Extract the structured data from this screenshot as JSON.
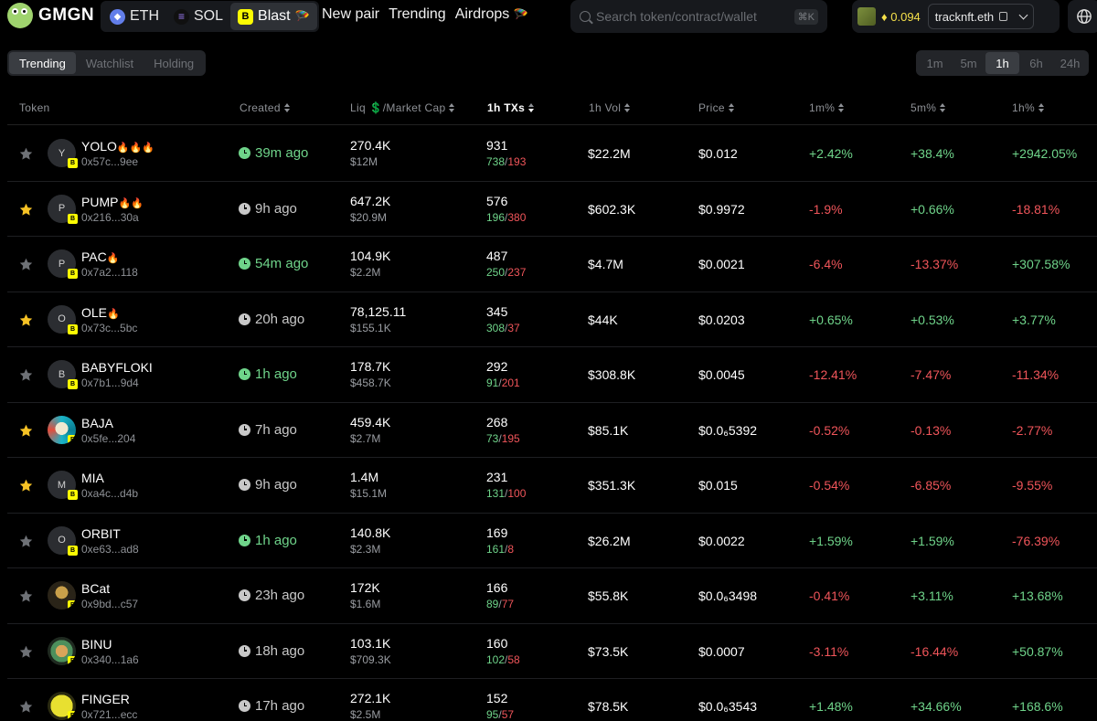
{
  "brand": {
    "name": "GMGN"
  },
  "chains": [
    {
      "label": "ETH",
      "icon": "eth-icon",
      "active": false
    },
    {
      "label": "SOL",
      "icon": "sol-icon",
      "active": false
    },
    {
      "label": "Blast",
      "icon": "blast-icon",
      "active": true
    }
  ],
  "nav": {
    "new_pair": "New pair",
    "trending": "Trending",
    "airdrops": "Airdrops"
  },
  "search": {
    "placeholder": "Search token/contract/wallet",
    "shortcut": "⌘K"
  },
  "wallet": {
    "balance": "0.094",
    "account": "tracknft.eth"
  },
  "tabs": [
    "Trending",
    "Watchlist",
    "Holding"
  ],
  "intervals": [
    "1m",
    "5m",
    "1h",
    "6h",
    "24h"
  ],
  "active_interval": "1h",
  "table": {
    "headers": {
      "token": "Token",
      "created": "Created",
      "liq": "Liq 💲/Market Cap",
      "txs": "1h TXs",
      "vol": "1h Vol",
      "price": "Price",
      "m1": "1m%",
      "m5": "5m%",
      "h1": "1h%"
    },
    "rows": [
      {
        "starred": false,
        "avatar": "Y",
        "name": "YOLO",
        "fire": "🔥🔥🔥",
        "addr": "0x57c...9ee",
        "created": "39m ago",
        "recent": true,
        "liq": "270.4K",
        "mcap": "$12M",
        "txs": "931",
        "buys": "738",
        "sells": "193",
        "vol": "$22.2M",
        "price": "$0.012",
        "m1": "+2.42%",
        "m5": "+38.4%",
        "h1": "+2942.05%"
      },
      {
        "starred": true,
        "avatar": "P",
        "name": "PUMP",
        "fire": "🔥🔥",
        "addr": "0x216...30a",
        "created": "9h ago",
        "recent": false,
        "liq": "647.2K",
        "mcap": "$20.9M",
        "txs": "576",
        "buys": "196",
        "sells": "380",
        "vol": "$602.3K",
        "price": "$0.9972",
        "m1": "-1.9%",
        "m5": "+0.66%",
        "h1": "-18.81%"
      },
      {
        "starred": false,
        "avatar": "P",
        "name": "PAC",
        "fire": "🔥",
        "addr": "0x7a2...118",
        "created": "54m ago",
        "recent": true,
        "liq": "104.9K",
        "mcap": "$2.2M",
        "txs": "487",
        "buys": "250",
        "sells": "237",
        "vol": "$4.7M",
        "price": "$0.0021",
        "m1": "-6.4%",
        "m5": "-13.37%",
        "h1": "+307.58%"
      },
      {
        "starred": true,
        "avatar": "O",
        "name": "OLE",
        "fire": "🔥",
        "addr": "0x73c...5bc",
        "created": "20h ago",
        "recent": false,
        "liq": "78,125.11",
        "mcap": "$155.1K",
        "txs": "345",
        "buys": "308",
        "sells": "37",
        "vol": "$44K",
        "price": "$0.0203",
        "m1": "+0.65%",
        "m5": "+0.53%",
        "h1": "+3.77%"
      },
      {
        "starred": false,
        "avatar": "B",
        "name": "BABYFLOKI",
        "fire": "",
        "addr": "0x7b1...9d4",
        "created": "1h ago",
        "recent": true,
        "liq": "178.7K",
        "mcap": "$458.7K",
        "txs": "292",
        "buys": "91",
        "sells": "201",
        "vol": "$308.8K",
        "price": "$0.0045",
        "m1": "-12.41%",
        "m5": "-7.47%",
        "h1": "-11.34%"
      },
      {
        "starred": true,
        "avatar": "",
        "name": "BAJA",
        "fire": "",
        "addr": "0x5fe...204",
        "created": "7h ago",
        "recent": false,
        "liq": "459.4K",
        "mcap": "$2.7M",
        "txs": "268",
        "buys": "73",
        "sells": "195",
        "vol": "$85.1K",
        "price": "$0.0₆5392",
        "m1": "-0.52%",
        "m5": "-0.13%",
        "h1": "-2.77%"
      },
      {
        "starred": true,
        "avatar": "M",
        "name": "MIA",
        "fire": "",
        "addr": "0xa4c...d4b",
        "created": "9h ago",
        "recent": false,
        "liq": "1.4M",
        "mcap": "$15.1M",
        "txs": "231",
        "buys": "131",
        "sells": "100",
        "vol": "$351.3K",
        "price": "$0.015",
        "m1": "-0.54%",
        "m5": "-6.85%",
        "h1": "-9.55%"
      },
      {
        "starred": false,
        "avatar": "O",
        "name": "ORBIT",
        "fire": "",
        "addr": "0xe63...ad8",
        "created": "1h ago",
        "recent": true,
        "liq": "140.8K",
        "mcap": "$2.3M",
        "txs": "169",
        "buys": "161",
        "sells": "8",
        "vol": "$26.2M",
        "price": "$0.0022",
        "m1": "+1.59%",
        "m5": "+1.59%",
        "h1": "-76.39%"
      },
      {
        "starred": false,
        "avatar": "",
        "name": "BCat",
        "fire": "",
        "addr": "0x9bd...c57",
        "created": "23h ago",
        "recent": false,
        "liq": "172K",
        "mcap": "$1.6M",
        "txs": "166",
        "buys": "89",
        "sells": "77",
        "vol": "$55.8K",
        "price": "$0.0₆3498",
        "m1": "-0.41%",
        "m5": "+3.11%",
        "h1": "+13.68%"
      },
      {
        "starred": false,
        "avatar": "",
        "name": "BINU",
        "fire": "",
        "addr": "0x340...1a6",
        "created": "18h ago",
        "recent": false,
        "liq": "103.1K",
        "mcap": "$709.3K",
        "txs": "160",
        "buys": "102",
        "sells": "58",
        "vol": "$73.5K",
        "price": "$0.0007",
        "m1": "-3.11%",
        "m5": "-16.44%",
        "h1": "+50.87%"
      },
      {
        "starred": false,
        "avatar": "",
        "name": "FINGER",
        "fire": "",
        "addr": "0x721...ecc",
        "created": "17h ago",
        "recent": false,
        "liq": "272.1K",
        "mcap": "$2.5M",
        "txs": "152",
        "buys": "95",
        "sells": "57",
        "vol": "$78.5K",
        "price": "$0.0₆3543",
        "m1": "+1.48%",
        "m5": "+34.66%",
        "h1": "+168.6%"
      }
    ]
  },
  "colors": {
    "positive": "#6fd48a",
    "negative": "#f0555a",
    "star_on": "#f7c325",
    "star_off": "#6e7176",
    "blast": "#fcfc03"
  }
}
